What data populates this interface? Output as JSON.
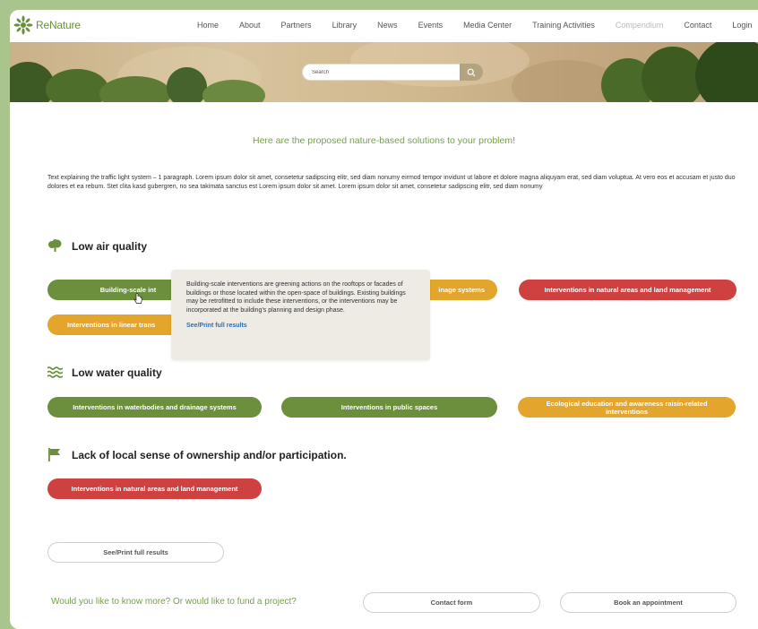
{
  "brand": {
    "name": "ReNature"
  },
  "nav": {
    "items": [
      "Home",
      "About",
      "Partners",
      "Library",
      "News",
      "Events",
      "Media Center",
      "Training Activities",
      "Compendium",
      "Contact",
      "Login"
    ],
    "faded_item": "Compendium"
  },
  "search": {
    "placeholder": "Search"
  },
  "intro": {
    "title": "Here are the proposed nature-based solutions to your problem!",
    "text": "Text explaining the traffic light system – 1 paragraph. Lorem ipsum dolor sit amet, consetetur sadipscing elitr, sed diam nonumy eirmod tempor invidunt ut labore et dolore magna aliquyam erat, sed diam voluptua. At vero eos et accusam et justo duo dolores et ea rebum. Stet clita kasd gubergren, no sea takimata sanctus est Lorem ipsum dolor sit amet. Lorem ipsum dolor sit amet, consetetur sadipscing elitr, sed diam nonumy"
  },
  "sections": {
    "air": {
      "title": "Low air quality",
      "pills": [
        "Building-scale int",
        "inage systems",
        "Interventions in natural areas and land management",
        "Interventions in linear trans"
      ]
    },
    "water": {
      "title": "Low water quality",
      "pills": [
        "Interventions in waterbodies and drainage systems",
        "Interventions in public spaces",
        "Ecological education and awareness raisin-related interventions"
      ]
    },
    "ownership": {
      "title": "Lack of local sense of ownership and/or participation.",
      "pills": [
        "Interventions in natural areas and land management"
      ]
    }
  },
  "tooltip": {
    "text": "Building-scale interventions are greening actions on the rooftops or facades of buildings or those located within the open-space of buildings. Existing buildings may be retrofitted to include these interventions, or the interventions may be incorporated at the building's planning and design phase.",
    "link": "See/Print full results"
  },
  "actions": {
    "see_print": "See/Print full results",
    "question": "Would you like to know more? Or would like to fund a project?",
    "contact": "Contact form",
    "book": "Book an appointment"
  },
  "colors": {
    "green": "#6b8f3c",
    "orange": "#e3a52b",
    "red": "#cf4141",
    "accent_text": "#76a04a",
    "background": "#a9c48c"
  }
}
